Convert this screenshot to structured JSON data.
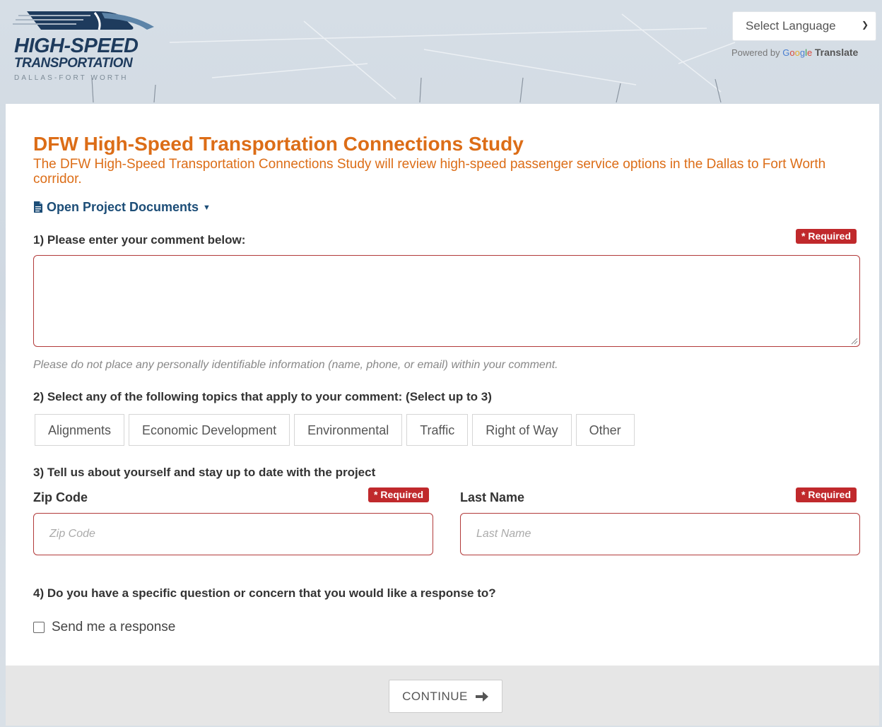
{
  "header": {
    "logo": {
      "title": "HIGH-SPEED",
      "subtitle": "TRANSPORTATION",
      "city": "DALLAS-FORT WORTH"
    },
    "language": {
      "selected": "Select Language",
      "powered_prefix": "Powered by",
      "google_letters": [
        "G",
        "o",
        "o",
        "g",
        "l",
        "e"
      ],
      "translate": "Translate"
    }
  },
  "main": {
    "title": "DFW High-Speed Transportation Connections Study",
    "description": "The DFW High-Speed Transportation Connections Study will review high-speed passenger service options in the Dallas to Fort Worth corridor.",
    "docs_link": "Open Project Documents",
    "required_label": "* Required",
    "q1": {
      "label": "1) Please enter your comment below:",
      "hint": "Please do not place any personally identifiable information (name, phone, or email) within your comment."
    },
    "q2": {
      "label": "2) Select any of the following topics that apply to your comment: (Select up to 3)",
      "topics": [
        "Alignments",
        "Economic Development",
        "Environmental",
        "Traffic",
        "Right of Way",
        "Other"
      ]
    },
    "q3": {
      "label": "3) Tell us about yourself and stay up to date with the project",
      "zip_label": "Zip Code",
      "zip_placeholder": "Zip Code",
      "last_name_label": "Last Name",
      "last_name_placeholder": "Last Name"
    },
    "q4": {
      "label": "4) Do you have a specific question or concern that you would like a response to?",
      "checkbox_label": "Send me a response"
    },
    "continue_label": "CONTINUE"
  },
  "colors": {
    "accent_orange": "#dc6d17",
    "link_blue": "#1c4d77",
    "required_red": "#c0292c"
  }
}
